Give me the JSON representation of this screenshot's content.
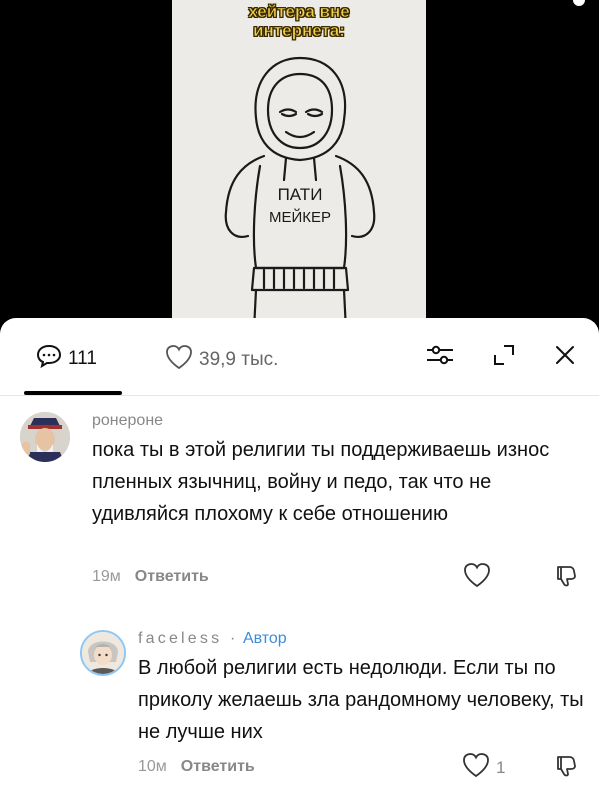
{
  "video": {
    "caption_lines": [
      "хейтера вне",
      "интернета:"
    ],
    "hoodie_text": [
      "ПАТИ",
      "МЕЙКЕР"
    ]
  },
  "tabs": {
    "comments_count": "111",
    "likes_count": "39,9 тыс."
  },
  "comments": [
    {
      "author": "ронероне",
      "text": "пока ты в этой религии ты поддерживаешь износ пленных язычниц, войну и педо, так что не удивляйся плохому к себе отношению",
      "time": "19м",
      "reply_label": "Ответить",
      "likes": ""
    },
    {
      "author": "faceless",
      "badge_sep": "·",
      "badge": "Автор",
      "text": "В любой религии есть недолюди. Если ты по приколу желаешь зла рандомному человеку, ты не лучше них",
      "time": "10м",
      "reply_label": "Ответить",
      "likes": "1"
    }
  ],
  "colors": {
    "badge": "#3d8cd8",
    "caption": "#f2d14a",
    "avatar_ring": "#8ec7f5"
  },
  "icons": [
    "comment-bubble-icon",
    "heart-icon",
    "filter-sliders-icon",
    "expand-icon",
    "close-icon",
    "like-icon",
    "dislike-icon"
  ]
}
